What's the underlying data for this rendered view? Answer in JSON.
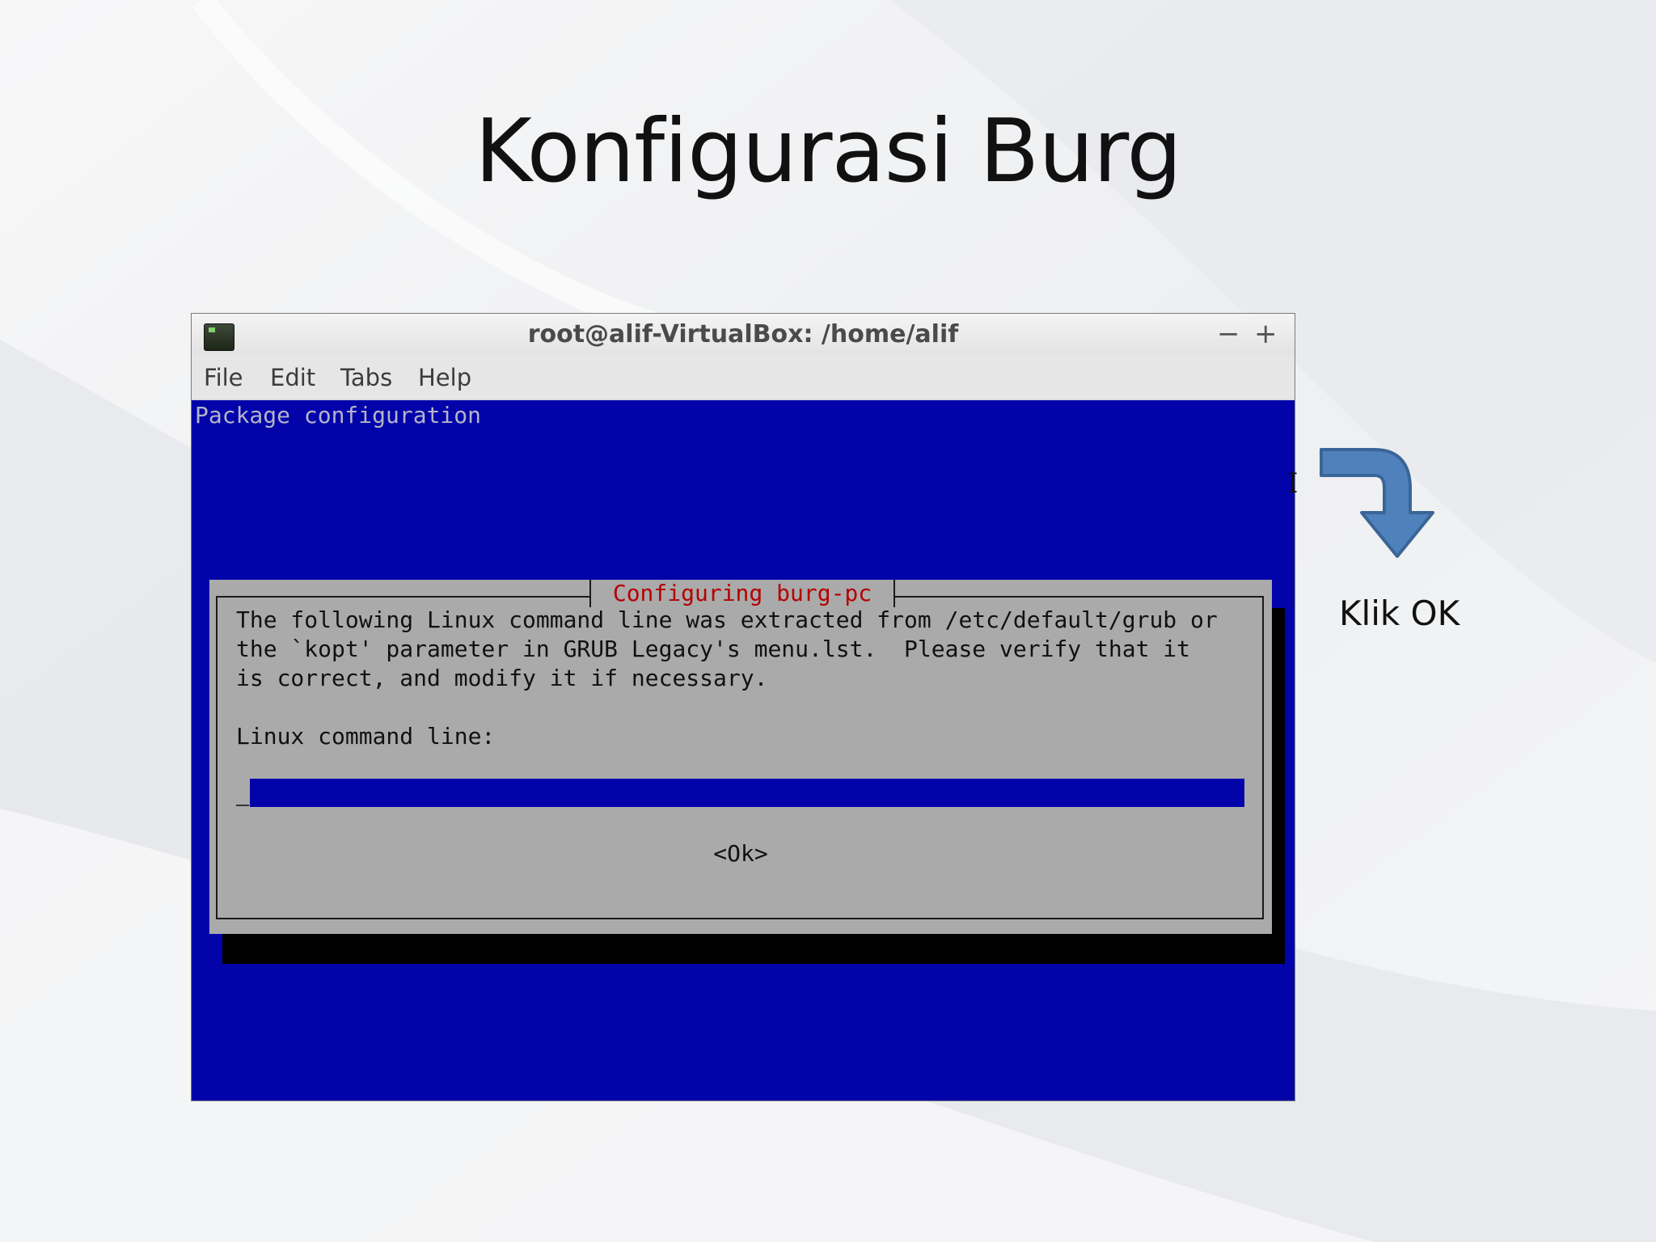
{
  "slide": {
    "title": "Konfigurasi Burg",
    "annotation": "Klik OK"
  },
  "window": {
    "title": "root@alif-VirtualBox: /home/alif",
    "controls": {
      "minimize": "−",
      "maximize": "+"
    },
    "menu": [
      "File",
      "Edit",
      "Tabs",
      "Help"
    ]
  },
  "terminal": {
    "header": "Package configuration",
    "dialog": {
      "title": "Configuring burg-pc",
      "lines": [
        "The following Linux command line was extracted from /etc/default/grub or",
        "the `kopt' parameter in GRUB Legacy's menu.lst.  Please verify that it",
        "is correct, and modify it if necessary."
      ],
      "prompt": "Linux command line:",
      "input_value": "",
      "ok_label": "<Ok>"
    }
  },
  "colors": {
    "terminal_bg": "#0303aa",
    "dialog_bg": "#aaaaaa",
    "dialog_title": "#b40000",
    "arrow_fill": "#4f81bd"
  },
  "icons": [
    "terminal-app-icon",
    "minimize-icon",
    "maximize-icon",
    "text-cursor-icon",
    "curved-arrow-icon"
  ]
}
